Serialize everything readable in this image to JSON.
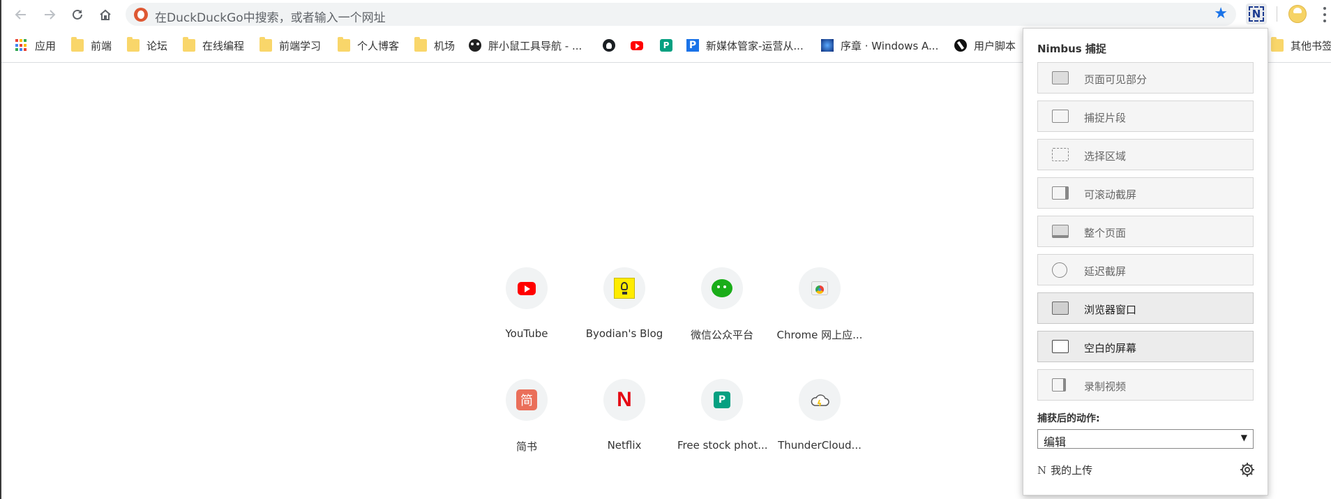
{
  "toolbar": {
    "omnibox_placeholder": "在DuckDuckGo中搜索，或者输入一个网址",
    "back_icon": "arrow-left-icon",
    "forward_icon": "arrow-right-icon",
    "reload_icon": "reload-icon",
    "home_icon": "home-icon",
    "bookmark_star_color": "#1a73e8"
  },
  "bookmarks": [
    {
      "label": "应用",
      "icon": "apps-grid-icon"
    },
    {
      "label": "前端",
      "icon": "folder-icon"
    },
    {
      "label": "论坛",
      "icon": "folder-icon"
    },
    {
      "label": "在线编程",
      "icon": "folder-icon"
    },
    {
      "label": "前端学习",
      "icon": "folder-icon"
    },
    {
      "label": "个人博客",
      "icon": "folder-icon"
    },
    {
      "label": "机场",
      "icon": "folder-icon"
    },
    {
      "label": "胖小鼠工具导航 - ...",
      "icon": "mouse-icon"
    },
    {
      "label": "",
      "icon": "github-icon"
    },
    {
      "label": "",
      "icon": "youtube-icon"
    },
    {
      "label": "",
      "icon": "pexels-icon"
    },
    {
      "label": "新媒体管家-运营从...",
      "icon": "p-icon"
    },
    {
      "label": "序章 · Windows A...",
      "icon": "windows-a-icon"
    },
    {
      "label": "用户脚本",
      "icon": "userscript-icon"
    },
    {
      "label": "其他书签",
      "icon": "folder-icon"
    }
  ],
  "tiles": [
    {
      "label": "YouTube",
      "icon": "youtube-icon"
    },
    {
      "label": "Byodian's Blog",
      "icon": "lightbulb-icon"
    },
    {
      "label": "微信公众平台",
      "icon": "wechat-icon"
    },
    {
      "label": "Chrome 网上应...",
      "icon": "chrome-webstore-icon"
    },
    {
      "label": "简书",
      "icon": "jianshu-icon"
    },
    {
      "label": "Netflix",
      "icon": "netflix-icon"
    },
    {
      "label": "Free stock phot...",
      "icon": "pexels-icon"
    },
    {
      "label": "ThunderCloud...",
      "icon": "cloud-icon"
    }
  ],
  "nimbus": {
    "title": "Nimbus 捕捉",
    "buttons": [
      {
        "label": "页面可见部分",
        "icon": "visible-part-icon"
      },
      {
        "label": "捕捉片段",
        "icon": "fragment-icon"
      },
      {
        "label": "选择区域",
        "icon": "select-area-icon"
      },
      {
        "label": "可滚动截屏",
        "icon": "scroll-capture-icon"
      },
      {
        "label": "整个页面",
        "icon": "entire-page-icon"
      },
      {
        "label": "延迟截屏",
        "icon": "timer-icon"
      },
      {
        "label": "浏览器窗口",
        "icon": "browser-window-icon"
      },
      {
        "label": "空白的屏幕",
        "icon": "blank-screen-icon"
      },
      {
        "label": "录制视频",
        "icon": "video-icon"
      }
    ],
    "after_capture_label": "捕获后的动作:",
    "after_capture_value": "编辑",
    "uploads_label": "我的上传",
    "uploads_logo": "N"
  }
}
